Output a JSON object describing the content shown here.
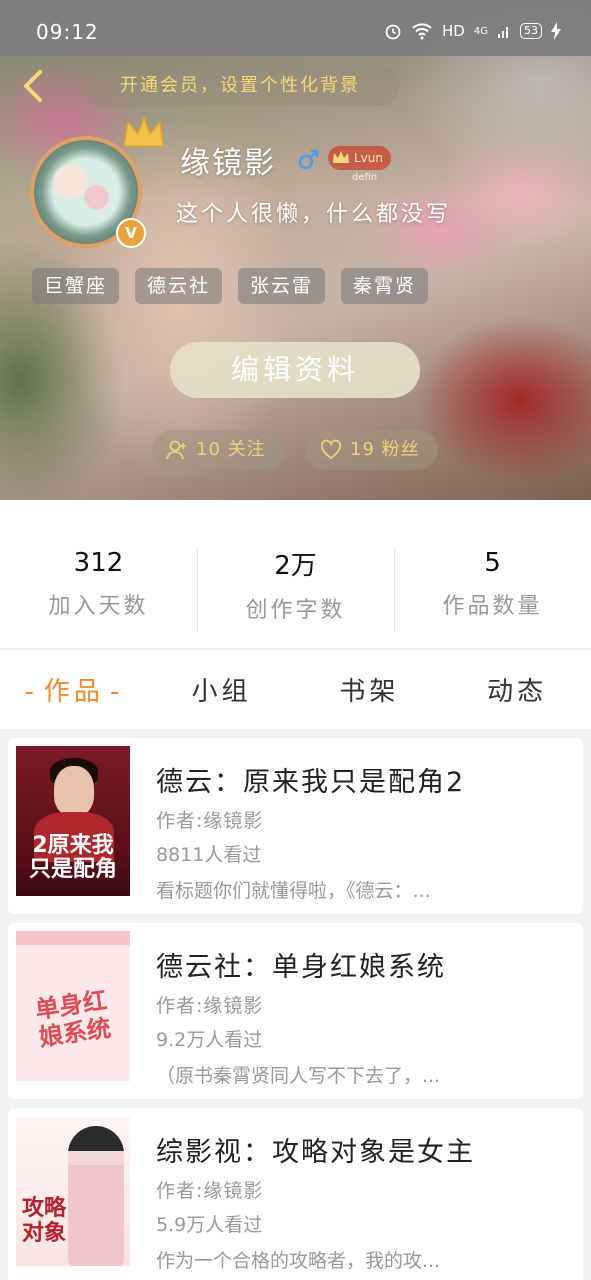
{
  "status_bar": {
    "time": "09:12",
    "network": "HD",
    "signal": "4G",
    "battery": "53"
  },
  "header": {
    "vip_banner": "开通会员，设置个性化背景"
  },
  "profile": {
    "username": "缘镜影",
    "badge_text": "Lvun",
    "badge_sub": "defin",
    "bio": "这个人很懒，什么都没写",
    "avatar_badge": "V",
    "tags": [
      "巨蟹座",
      "德云社",
      "张云雷",
      "秦霄贤"
    ],
    "edit_button": "编辑资料",
    "follow": "10 关注",
    "fans": "19 粉丝"
  },
  "stats": [
    {
      "value": "312",
      "label": "加入天数"
    },
    {
      "value": "2万",
      "label": "创作字数"
    },
    {
      "value": "5",
      "label": "作品数量"
    }
  ],
  "tabs": [
    {
      "label": "作品",
      "active": true
    },
    {
      "label": "小组",
      "active": false
    },
    {
      "label": "书架",
      "active": false
    },
    {
      "label": "动态",
      "active": false
    }
  ],
  "works": [
    {
      "title": "德云：原来我只是配角2",
      "author": "作者:缘镜影",
      "views": "8811人看过",
      "desc": "看标题你们就懂得啦，《德云：...",
      "cover_text": "2原来我\n只是配角"
    },
    {
      "title": "德云社：单身红娘系统",
      "author": "作者:缘镜影",
      "views": "9.2万人看过",
      "desc": "（原书秦霄贤同人写不下去了，...",
      "cover_text": "单身红\n娘系统"
    },
    {
      "title": "综影视：攻略对象是女主",
      "author": "作者:缘镜影",
      "views": "5.9万人看过",
      "desc": "作为一个合格的攻略者，我的攻...",
      "cover_text": "攻略\n对象"
    }
  ],
  "colors": {
    "accent": "#f08a2c",
    "vip_text": "#f7d97a",
    "avatar_ring": "#e2a066"
  }
}
